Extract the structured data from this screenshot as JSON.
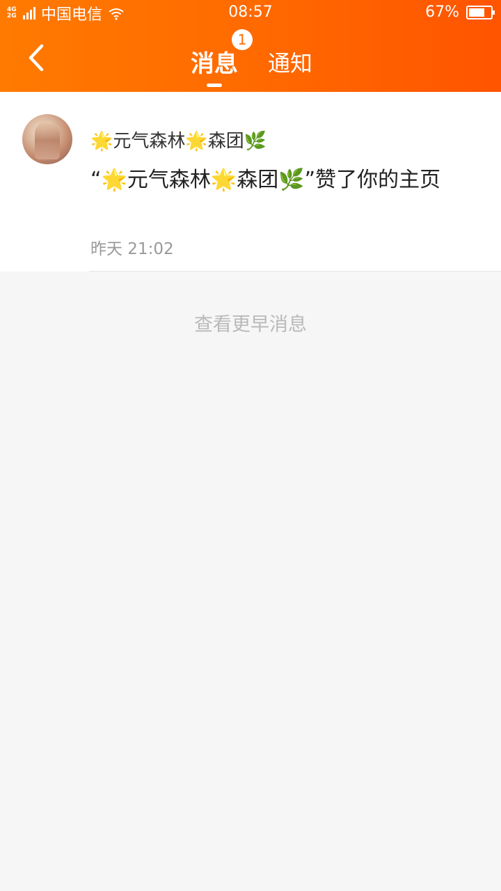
{
  "status_bar": {
    "network": "4G 2G",
    "carrier": "中国电信",
    "time": "08:57",
    "battery": "67%"
  },
  "nav": {
    "back_icon": "chevron-left-icon",
    "tab_messages": "消息",
    "tab_messages_badge": "1",
    "tab_notifications": "通知"
  },
  "message": {
    "sender": "🌟元气森林🌟森团🌿",
    "text": "“🌟元气森林🌟森团🌿”赞了你的主页",
    "time": "昨天 21:02"
  },
  "older_messages": "查看更早消息",
  "colors": {
    "header_start": "#ff7a00",
    "header_end": "#ff5400",
    "background": "#f6f6f6"
  }
}
